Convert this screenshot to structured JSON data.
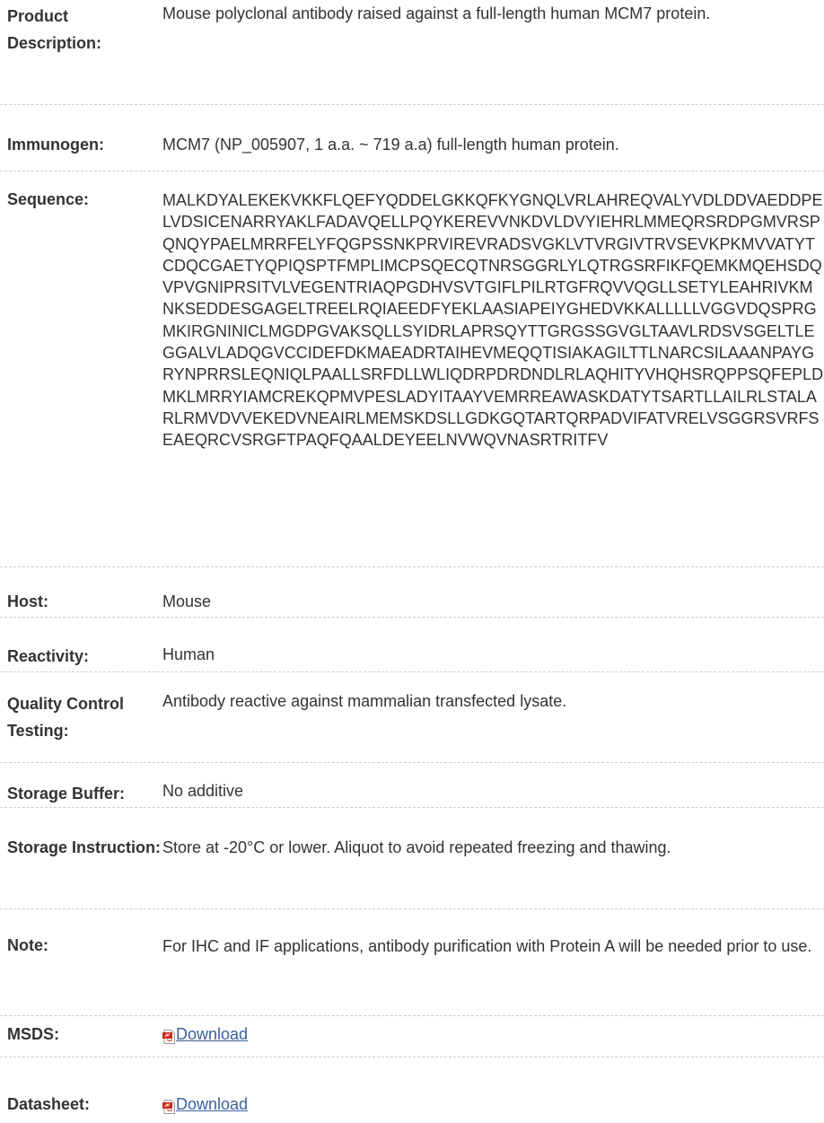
{
  "specs": {
    "product_description": {
      "label": "Product Description:",
      "value": "Mouse polyclonal antibody raised against a full-length human MCM7 protein."
    },
    "immunogen": {
      "label": "Immunogen:",
      "value": "MCM7 (NP_005907, 1 a.a. ~ 719 a.a) full-length human protein."
    },
    "sequence": {
      "label": "Sequence:",
      "value": "MALKDYALEKEKVKKFLQEFYQDDELGKKQFKYGNQLVRLAHREQVALYVDLDDVAEDDPELVDSICENARRYAKLFADAVQELLPQYKEREVVNKDVLDVYIEHRLMMEQRSRDPGMVRSPQNQYPAELMRRFELYFQGPSSNKPRVIREVRADSVGKLVTVRGIVTRVSEVKPKMVVATYTCDQCGAETYQPIQSPTFMPLIMCPSQECQTNRSGGRLYLQTRGSRFIKFQEMKMQEHSDQVPVGNIPRSITVLVEGENTRIAQPGDHVSVTGIFLPILRTGFRQVVQGLLSETYLEAHRIVKMNKSEDDESGAGELTREELRQIAEEDFYEKLAASIAPEIYGHEDVKKALLLLLVGGVDQSPRGMKIRGNINICLMGDPGVAKSQLLSYIDRLAPRSQYTTGRGSSGVGLTAAVLRDSVSGELTLEGGALVLADQGVCCIDEFDKMAEADRTAIHEVMEQQTISIAKAGILTTLNARCSILAAANPAYGRYNPRRSLEQNIQLPAALLSRFDLLWLIQDRPDRDNDLRLAQHITYVHQHSRQPPSQFEPLDMKLMRRYIAMCREKQPMVPESLADYITAAYVEMRREAWASKDATYTSARTLLAILRLSTALARLRMVDVVEKEDVNEAIRLMEMSKDSLLGDKGQTARTQRPADVIFATVRELVSGGRSVRFSEAEQRCVSRGFTPAQFQAALDEYEELNVWQVNASRTRITFV"
    },
    "host": {
      "label": "Host:",
      "value": "Mouse"
    },
    "reactivity": {
      "label": "Reactivity:",
      "value": "Human"
    },
    "quality_control": {
      "label": "Quality Control Testing:",
      "value": "Antibody reactive against mammalian transfected lysate."
    },
    "storage_buffer": {
      "label": "Storage Buffer:",
      "value": "No additive"
    },
    "storage_instruction": {
      "label": "Storage Instruction:",
      "value": "Store at -20°C or lower. Aliquot to avoid repeated freezing and thawing."
    },
    "note": {
      "label": "Note:",
      "value": "For IHC and IF applications, antibody purification with Protein A will be needed prior to use."
    },
    "msds": {
      "label": "MSDS:",
      "link_text": "Download",
      "icon": "pdf-icon"
    },
    "datasheet": {
      "label": "Datasheet:",
      "link_text": "Download",
      "icon": "pdf-icon"
    }
  },
  "colors": {
    "text": "#333333",
    "link": "#3a5fa0",
    "divider": "#cccccc",
    "pdf_red": "#cc2a1e"
  }
}
